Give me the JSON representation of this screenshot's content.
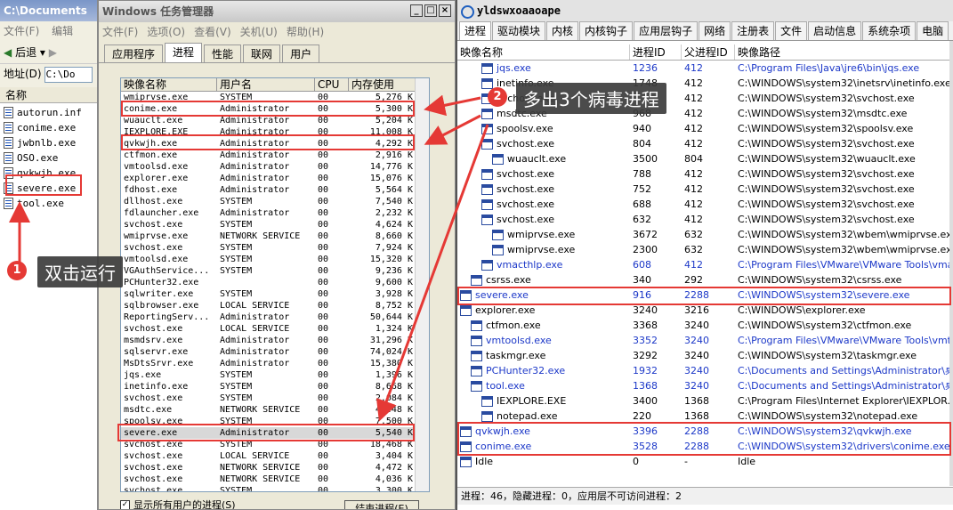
{
  "explorer": {
    "title": "C:\\Documents",
    "menu": [
      "文件(F)",
      "编辑"
    ],
    "back_label": "后退",
    "address_label": "地址(D)",
    "address_value": "C:\\Do",
    "column_name": "名称",
    "files": [
      "autorun.inf",
      "conime.exe",
      "jwbnlb.exe",
      "OSO.exe",
      "qvkwjh.exe",
      "severe.exe",
      "tool.exe"
    ]
  },
  "taskmgr": {
    "title": "Windows 任务管理器",
    "menu": [
      "文件(F)",
      "选项(O)",
      "查看(V)",
      "关机(U)",
      "帮助(H)"
    ],
    "tabs": [
      "应用程序",
      "进程",
      "性能",
      "联网",
      "用户"
    ],
    "columns": [
      "映像名称",
      "用户名",
      "CPU",
      "内存使用"
    ],
    "rows": [
      [
        "wmiprvse.exe",
        "SYSTEM",
        "00",
        "5,276 K"
      ],
      [
        "conime.exe",
        "Administrator",
        "00",
        "5,300 K"
      ],
      [
        "wuauclt.exe",
        "Administrator",
        "00",
        "5,204 K"
      ],
      [
        "IEXPLORE.EXE",
        "Administrator",
        "00",
        "11,008 K"
      ],
      [
        "qvkwjh.exe",
        "Administrator",
        "00",
        "4,292 K"
      ],
      [
        "ctfmon.exe",
        "Administrator",
        "00",
        "2,916 K"
      ],
      [
        "vmtoolsd.exe",
        "Administrator",
        "00",
        "14,776 K"
      ],
      [
        "explorer.exe",
        "Administrator",
        "00",
        "15,076 K"
      ],
      [
        "fdhost.exe",
        "Administrator",
        "00",
        "5,564 K"
      ],
      [
        "dllhost.exe",
        "SYSTEM",
        "00",
        "7,540 K"
      ],
      [
        "fdlauncher.exe",
        "Administrator",
        "00",
        "2,232 K"
      ],
      [
        "svchost.exe",
        "SYSTEM",
        "00",
        "4,624 K"
      ],
      [
        "wmiprvse.exe",
        "NETWORK SERVICE",
        "00",
        "8,660 K"
      ],
      [
        "svchost.exe",
        "SYSTEM",
        "00",
        "7,924 K"
      ],
      [
        "vmtoolsd.exe",
        "SYSTEM",
        "00",
        "15,320 K"
      ],
      [
        "VGAuthService...",
        "SYSTEM",
        "00",
        "9,236 K"
      ],
      [
        "PCHunter32.exe",
        "",
        "00",
        "9,600 K"
      ],
      [
        "sqlwriter.exe",
        "SYSTEM",
        "00",
        "3,928 K"
      ],
      [
        "sqlbrowser.exe",
        "LOCAL SERVICE",
        "00",
        "8,752 K"
      ],
      [
        "ReportingServ...",
        "Administrator",
        "00",
        "50,644 K"
      ],
      [
        "svchost.exe",
        "LOCAL SERVICE",
        "00",
        "1,324 K"
      ],
      [
        "msmdsrv.exe",
        "Administrator",
        "00",
        "31,296 K"
      ],
      [
        "sqlservr.exe",
        "Administrator",
        "00",
        "74,024 K"
      ],
      [
        "MsDtsSrvr.exe",
        "Administrator",
        "00",
        "15,380 K"
      ],
      [
        "jqs.exe",
        "SYSTEM",
        "00",
        "1,396 K"
      ],
      [
        "inetinfo.exe",
        "SYSTEM",
        "00",
        "8,668 K"
      ],
      [
        "svchost.exe",
        "SYSTEM",
        "00",
        "2,084 K"
      ],
      [
        "msdtc.exe",
        "NETWORK SERVICE",
        "00",
        "4,448 K"
      ],
      [
        "spoolsv.exe",
        "SYSTEM",
        "00",
        "7,500 K"
      ],
      [
        "severe.exe",
        "Administrator",
        "00",
        "5,540 K"
      ],
      [
        "svchost.exe",
        "SYSTEM",
        "00",
        "18,468 K"
      ],
      [
        "svchost.exe",
        "LOCAL SERVICE",
        "00",
        "3,404 K"
      ],
      [
        "svchost.exe",
        "NETWORK SERVICE",
        "00",
        "4,472 K"
      ],
      [
        "svchost.exe",
        "NETWORK SERVICE",
        "00",
        "4,036 K"
      ],
      [
        "svchost.exe",
        "SYSTEM",
        "00",
        "3,300 K"
      ]
    ],
    "show_all_label": "显示所有用户的进程(S)",
    "end_button": "结束进程(E)"
  },
  "pchunter": {
    "title": "yldswxoaaoape",
    "tabs": [
      "进程",
      "驱动模块",
      "内核",
      "内核钩子",
      "应用层钩子",
      "网络",
      "注册表",
      "文件",
      "启动信息",
      "系统杂项",
      "电脑"
    ],
    "columns": [
      "映像名称",
      "进程ID",
      "父进程ID",
      "映像路径"
    ],
    "rows": [
      {
        "name": "jqs.exe",
        "pid": "1236",
        "ppid": "412",
        "path": "C:\\Program Files\\Java\\jre6\\bin\\jqs.exe",
        "blue": true,
        "indent": 2
      },
      {
        "name": "inetinfo.exe",
        "pid": "1748",
        "ppid": "412",
        "path": "C:\\WINDOWS\\system32\\inetsrv\\inetinfo.exe",
        "blue": false,
        "indent": 2
      },
      {
        "name": "svchost.exe",
        "pid": "",
        "ppid": "412",
        "path": "C:\\WINDOWS\\system32\\svchost.exe",
        "blue": false,
        "indent": 2
      },
      {
        "name": "msdtc.exe",
        "pid": "968",
        "ppid": "412",
        "path": "C:\\WINDOWS\\system32\\msdtc.exe",
        "blue": false,
        "indent": 2
      },
      {
        "name": "spoolsv.exe",
        "pid": "940",
        "ppid": "412",
        "path": "C:\\WINDOWS\\system32\\spoolsv.exe",
        "blue": false,
        "indent": 2
      },
      {
        "name": "svchost.exe",
        "pid": "804",
        "ppid": "412",
        "path": "C:\\WINDOWS\\system32\\svchost.exe",
        "blue": false,
        "indent": 2
      },
      {
        "name": "wuauclt.exe",
        "pid": "3500",
        "ppid": "804",
        "path": "C:\\WINDOWS\\system32\\wuauclt.exe",
        "blue": false,
        "indent": 3
      },
      {
        "name": "svchost.exe",
        "pid": "788",
        "ppid": "412",
        "path": "C:\\WINDOWS\\system32\\svchost.exe",
        "blue": false,
        "indent": 2
      },
      {
        "name": "svchost.exe",
        "pid": "752",
        "ppid": "412",
        "path": "C:\\WINDOWS\\system32\\svchost.exe",
        "blue": false,
        "indent": 2
      },
      {
        "name": "svchost.exe",
        "pid": "688",
        "ppid": "412",
        "path": "C:\\WINDOWS\\system32\\svchost.exe",
        "blue": false,
        "indent": 2
      },
      {
        "name": "svchost.exe",
        "pid": "632",
        "ppid": "412",
        "path": "C:\\WINDOWS\\system32\\svchost.exe",
        "blue": false,
        "indent": 2
      },
      {
        "name": "wmiprvse.exe",
        "pid": "3672",
        "ppid": "632",
        "path": "C:\\WINDOWS\\system32\\wbem\\wmiprvse.exe",
        "blue": false,
        "indent": 3
      },
      {
        "name": "wmiprvse.exe",
        "pid": "2300",
        "ppid": "632",
        "path": "C:\\WINDOWS\\system32\\wbem\\wmiprvse.exe",
        "blue": false,
        "indent": 3
      },
      {
        "name": "vmacthlp.exe",
        "pid": "608",
        "ppid": "412",
        "path": "C:\\Program Files\\VMware\\VMware Tools\\vma...",
        "blue": true,
        "indent": 2
      },
      {
        "name": "csrss.exe",
        "pid": "340",
        "ppid": "292",
        "path": "C:\\WINDOWS\\system32\\csrss.exe",
        "blue": false,
        "indent": 1
      },
      {
        "name": "severe.exe",
        "pid": "916",
        "ppid": "2288",
        "path": "C:\\WINDOWS\\system32\\severe.exe",
        "blue": true,
        "indent": 0
      },
      {
        "name": "explorer.exe",
        "pid": "3240",
        "ppid": "3216",
        "path": "C:\\WINDOWS\\explorer.exe",
        "blue": false,
        "indent": 0
      },
      {
        "name": "ctfmon.exe",
        "pid": "3368",
        "ppid": "3240",
        "path": "C:\\WINDOWS\\system32\\ctfmon.exe",
        "blue": false,
        "indent": 1
      },
      {
        "name": "vmtoolsd.exe",
        "pid": "3352",
        "ppid": "3240",
        "path": "C:\\Program Files\\VMware\\VMware Tools\\vmt...",
        "blue": true,
        "indent": 1
      },
      {
        "name": "taskmgr.exe",
        "pid": "3292",
        "ppid": "3240",
        "path": "C:\\WINDOWS\\system32\\taskmgr.exe",
        "blue": false,
        "indent": 1
      },
      {
        "name": "PCHunter32.exe",
        "pid": "1932",
        "ppid": "3240",
        "path": "C:\\Documents and Settings\\Administrator\\桌...",
        "blue": true,
        "indent": 1
      },
      {
        "name": "tool.exe",
        "pid": "1368",
        "ppid": "3240",
        "path": "C:\\Documents and Settings\\Administrator\\桌...",
        "blue": true,
        "indent": 1
      },
      {
        "name": "IEXPLORE.EXE",
        "pid": "3400",
        "ppid": "1368",
        "path": "C:\\Program Files\\Internet Explorer\\IEXPLOR...",
        "blue": false,
        "indent": 2
      },
      {
        "name": "notepad.exe",
        "pid": "220",
        "ppid": "1368",
        "path": "C:\\WINDOWS\\system32\\notepad.exe",
        "blue": false,
        "indent": 2
      },
      {
        "name": "qvkwjh.exe",
        "pid": "3396",
        "ppid": "2288",
        "path": "C:\\WINDOWS\\system32\\qvkwjh.exe",
        "blue": true,
        "indent": 0
      },
      {
        "name": "conime.exe",
        "pid": "3528",
        "ppid": "2288",
        "path": "C:\\WINDOWS\\system32\\drivers\\conime.exe",
        "blue": true,
        "indent": 0
      },
      {
        "name": "Idle",
        "pid": "0",
        "ppid": "-",
        "path": "Idle",
        "blue": false,
        "indent": 0
      }
    ],
    "status": "进程：46，隐藏进程：0，应用层不可访问进程：2"
  },
  "annotations": {
    "badge1": "1",
    "callout1": "双击运行",
    "badge2": "2",
    "callout2": "多出3个病毒进程",
    "color": "#e53935"
  }
}
